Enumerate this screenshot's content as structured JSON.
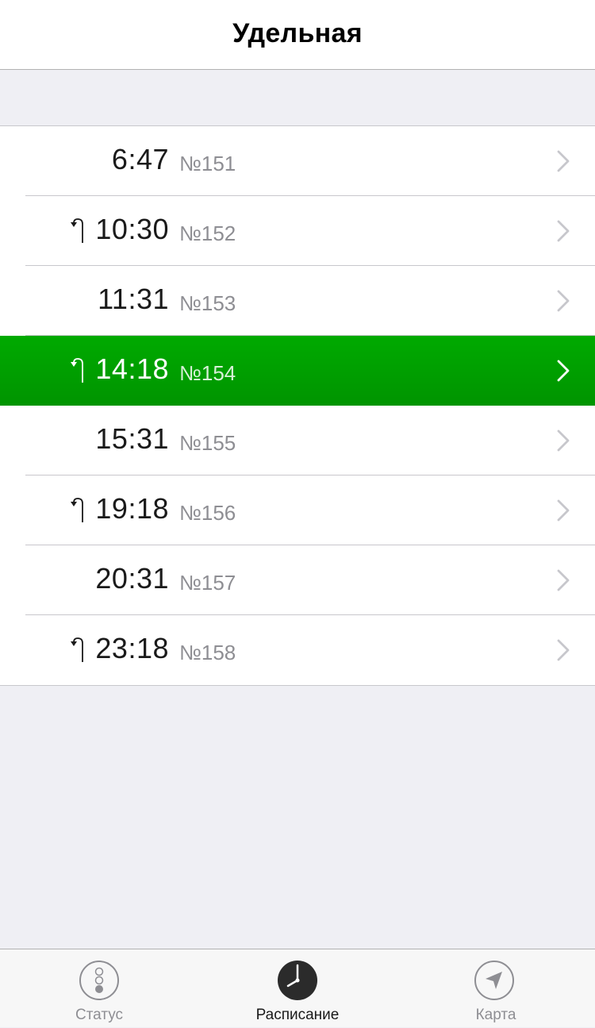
{
  "navbar": {
    "title": "Удельная"
  },
  "schedule": [
    {
      "time": "6:47",
      "number": "№151",
      "has_turn_icon": false,
      "active": false
    },
    {
      "time": "10:30",
      "number": "№152",
      "has_turn_icon": true,
      "active": false
    },
    {
      "time": "11:31",
      "number": "№153",
      "has_turn_icon": false,
      "active": false
    },
    {
      "time": "14:18",
      "number": "№154",
      "has_turn_icon": true,
      "active": true
    },
    {
      "time": "15:31",
      "number": "№155",
      "has_turn_icon": false,
      "active": false
    },
    {
      "time": "19:18",
      "number": "№156",
      "has_turn_icon": true,
      "active": false
    },
    {
      "time": "20:31",
      "number": "№157",
      "has_turn_icon": false,
      "active": false
    },
    {
      "time": "23:18",
      "number": "№158",
      "has_turn_icon": true,
      "active": false
    }
  ],
  "tabbar": {
    "tabs": [
      {
        "label": "Статус",
        "icon": "traffic-light-icon",
        "active": false
      },
      {
        "label": "Расписание",
        "icon": "clock-icon",
        "active": true
      },
      {
        "label": "Карта",
        "icon": "location-arrow-icon",
        "active": false
      }
    ]
  },
  "colors": {
    "active_row": "#00a000",
    "background": "#efeff4",
    "secondary_text": "#8e8e93"
  }
}
